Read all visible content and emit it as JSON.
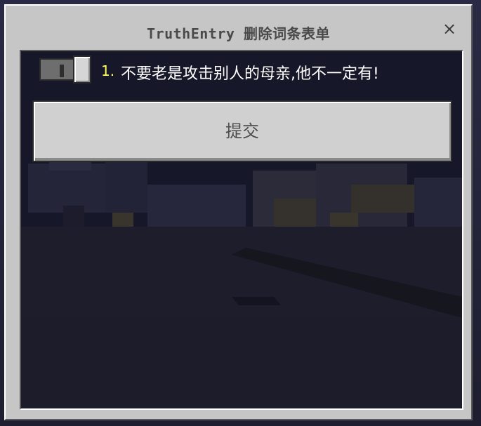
{
  "dialog": {
    "title": "TruthEntry 删除词条表单",
    "close_symbol": "×"
  },
  "entries": [
    {
      "number": "1.",
      "text": "不要老是攻击别人的母亲,他不一定有!",
      "toggle_on": false
    }
  ],
  "submit": {
    "label": "提交"
  },
  "colors": {
    "panel": "#c6c6c6",
    "content_bg": "#181826",
    "number_accent": "#ffff55",
    "button_face": "#d0d0d0"
  },
  "icons": {
    "close": "close-icon",
    "toggle": "toggle-switch"
  }
}
